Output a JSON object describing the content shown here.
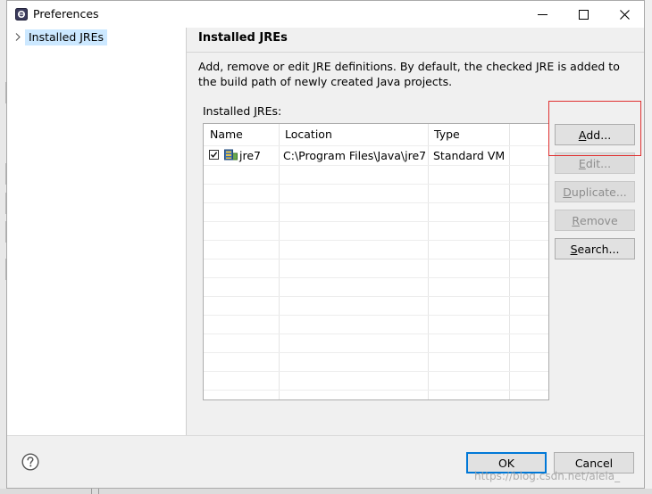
{
  "window": {
    "title": "Preferences",
    "controls": {
      "minimize": "minimize-icon",
      "maximize": "maximize-icon",
      "close": "close-icon"
    }
  },
  "tree": {
    "items": [
      {
        "label": "Installed JREs",
        "icon": "chevron-right-icon",
        "selected": true
      }
    ]
  },
  "page": {
    "title": "Installed JREs",
    "description": "Add, remove or edit JRE definitions. By default, the checked JRE is added to the build path of newly created Java projects.",
    "list_label_pre": "Installed ",
    "list_label_mnemonic": "J",
    "list_label_post": "REs:"
  },
  "table": {
    "columns": [
      "Name",
      "Location",
      "Type"
    ],
    "rows": [
      {
        "checked": true,
        "icon": "jre-icon",
        "name": "jre7",
        "location": "C:\\Program Files\\Java\\jre7",
        "type": "Standard VM"
      }
    ]
  },
  "buttons": {
    "add": {
      "label": "Add...",
      "mnemonic": "A",
      "rest": "dd...",
      "enabled": true
    },
    "edit": {
      "label": "Edit...",
      "mnemonic": "E",
      "rest": "dit...",
      "enabled": false
    },
    "duplicate": {
      "label": "Duplicate...",
      "mnemonic": "D",
      "rest": "uplicate...",
      "enabled": false
    },
    "remove": {
      "label": "Remove",
      "mnemonic": "R",
      "rest": "emove",
      "enabled": false
    },
    "search": {
      "label": "Search...",
      "mnemonic": "S",
      "rest": "earch...",
      "enabled": true
    }
  },
  "footer": {
    "help_icon": "help-icon",
    "ok_label": "OK",
    "cancel_label": "Cancel",
    "watermark": "https://blog.csdn.net/alela_"
  },
  "colors": {
    "selection": "#cce8ff",
    "highlight_box": "#e03030",
    "default_button_border": "#0078d7",
    "disabled_text": "#8d8d8d"
  }
}
